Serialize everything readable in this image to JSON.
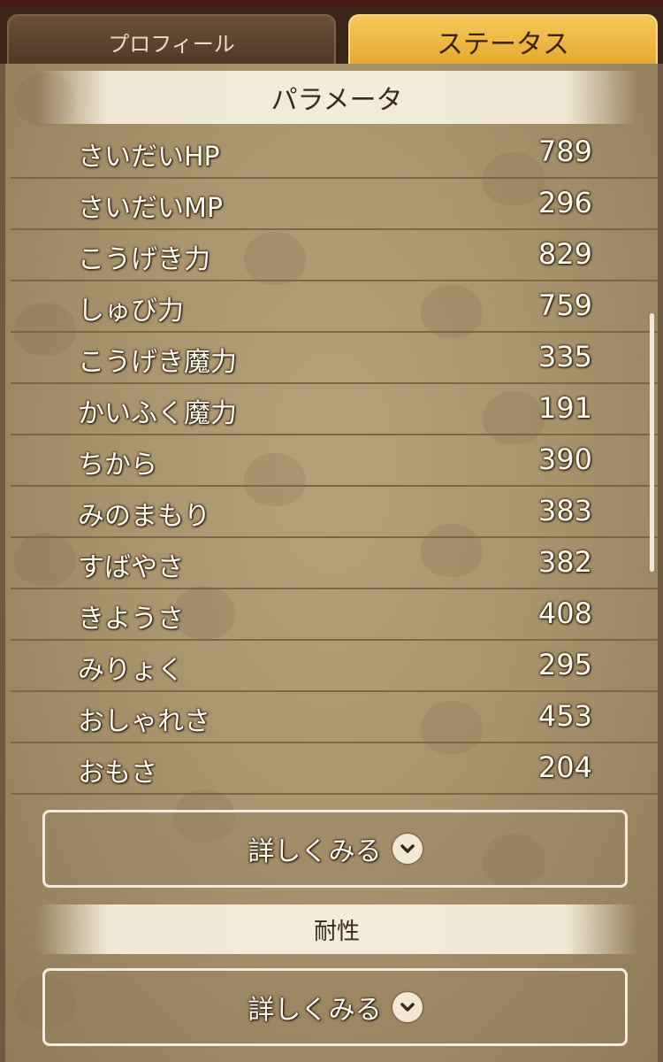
{
  "tabs": [
    {
      "label": "プロフィール",
      "active": false
    },
    {
      "label": "ステータス",
      "active": true
    }
  ],
  "parameters": {
    "header": "パラメータ",
    "rows": [
      {
        "label": "さいだいHP",
        "value": "789"
      },
      {
        "label": "さいだいMP",
        "value": "296"
      },
      {
        "label": "こうげき力",
        "value": "829"
      },
      {
        "label": "しゅび力",
        "value": "759"
      },
      {
        "label": "こうげき魔力",
        "value": "335"
      },
      {
        "label": "かいふく魔力",
        "value": "191"
      },
      {
        "label": "ちから",
        "value": "390"
      },
      {
        "label": "みのまもり",
        "value": "383"
      },
      {
        "label": "すばやさ",
        "value": "382"
      },
      {
        "label": "きようさ",
        "value": "408"
      },
      {
        "label": "みりょく",
        "value": "295"
      },
      {
        "label": "おしゃれさ",
        "value": "453"
      },
      {
        "label": "おもさ",
        "value": "204"
      }
    ],
    "detail_button": "詳しくみる"
  },
  "resistance": {
    "header": "耐性",
    "detail_button": "詳しくみる"
  },
  "icons": {
    "button_chevron": "chevron-down-icon"
  },
  "colors": {
    "active_tab": "#e5a72c",
    "parchment": "#a8946d",
    "text": "#fffaf0"
  }
}
